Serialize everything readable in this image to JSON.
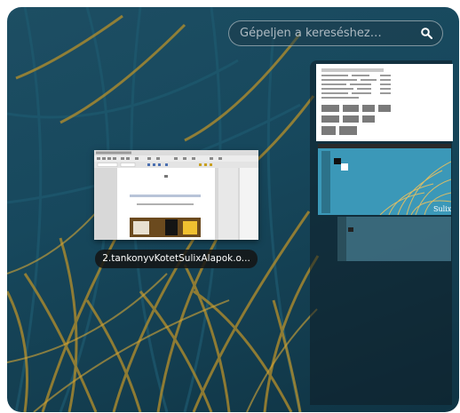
{
  "search": {
    "placeholder": "Gépeljen a kereséshez…",
    "icon": "search-icon"
  },
  "window": {
    "title": "2.tankonyvKotetSulixAlapok.o..."
  },
  "workspaces": [
    {
      "name": "workspace-1",
      "active": true
    },
    {
      "name": "workspace-2",
      "active": false
    },
    {
      "name": "workspace-3",
      "active": false
    }
  ],
  "workspace_2_logo": "Sulix",
  "colors": {
    "background": "#17485d",
    "grass": "#b8902a",
    "label_bg": "#141414"
  }
}
